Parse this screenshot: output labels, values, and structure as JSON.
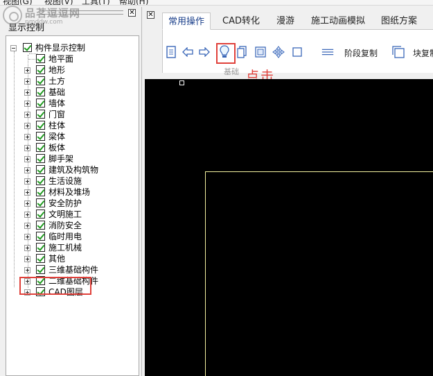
{
  "menubar": {
    "items": [
      "视图(G)",
      "视图(V)",
      "工具(T)",
      "帮助(H)"
    ]
  },
  "watermark": {
    "title": "品茗逗逗网",
    "url": "pmddw.com"
  },
  "left_panel": {
    "title": "显示控制",
    "close_glyph": "✕",
    "tree": {
      "root": {
        "label": "构件显示控制",
        "checked": true,
        "expanded": true
      },
      "children": [
        {
          "label": "地平面",
          "checked": true,
          "has_children": false
        },
        {
          "label": "地形",
          "checked": true,
          "has_children": true
        },
        {
          "label": "土方",
          "checked": true,
          "has_children": true
        },
        {
          "label": "基础",
          "checked": true,
          "has_children": true
        },
        {
          "label": "墙体",
          "checked": true,
          "has_children": true
        },
        {
          "label": "门窗",
          "checked": true,
          "has_children": true
        },
        {
          "label": "柱体",
          "checked": true,
          "has_children": true
        },
        {
          "label": "梁体",
          "checked": true,
          "has_children": true
        },
        {
          "label": "板体",
          "checked": true,
          "has_children": true
        },
        {
          "label": "脚手架",
          "checked": true,
          "has_children": true
        },
        {
          "label": "建筑及构筑物",
          "checked": true,
          "has_children": true
        },
        {
          "label": "生活设施",
          "checked": true,
          "has_children": true
        },
        {
          "label": "材料及堆场",
          "checked": true,
          "has_children": true
        },
        {
          "label": "安全防护",
          "checked": true,
          "has_children": true
        },
        {
          "label": "文明施工",
          "checked": true,
          "has_children": true
        },
        {
          "label": "消防安全",
          "checked": true,
          "has_children": true
        },
        {
          "label": "临时用电",
          "checked": true,
          "has_children": true
        },
        {
          "label": "施工机械",
          "checked": true,
          "has_children": true
        },
        {
          "label": "其他",
          "checked": true,
          "has_children": true
        },
        {
          "label": "三维基础构件",
          "checked": true,
          "has_children": true
        },
        {
          "label": "二维基础构件",
          "checked": true,
          "has_children": true
        }
      ],
      "last": {
        "label": "CAD图层",
        "checked": true,
        "has_children": true,
        "highlighted": true
      }
    }
  },
  "ribbon": {
    "close_glyph": "✕",
    "tabs": [
      {
        "label": "常用操作",
        "active": true
      },
      {
        "label": "CAD转化",
        "active": false
      },
      {
        "label": "漫游",
        "active": false
      },
      {
        "label": "施工动画模拟",
        "active": false
      },
      {
        "label": "图纸方案",
        "active": false
      }
    ],
    "group_label": "基础",
    "stage_copy_label": "阶段复制",
    "block_copy_label": "块复制",
    "annotation": "点击"
  },
  "colors": {
    "highlight_red": "#e0403a",
    "check_green": "#1f9a1f",
    "canvas_bg": "#000000",
    "cad_line": "#f5f3a0"
  }
}
